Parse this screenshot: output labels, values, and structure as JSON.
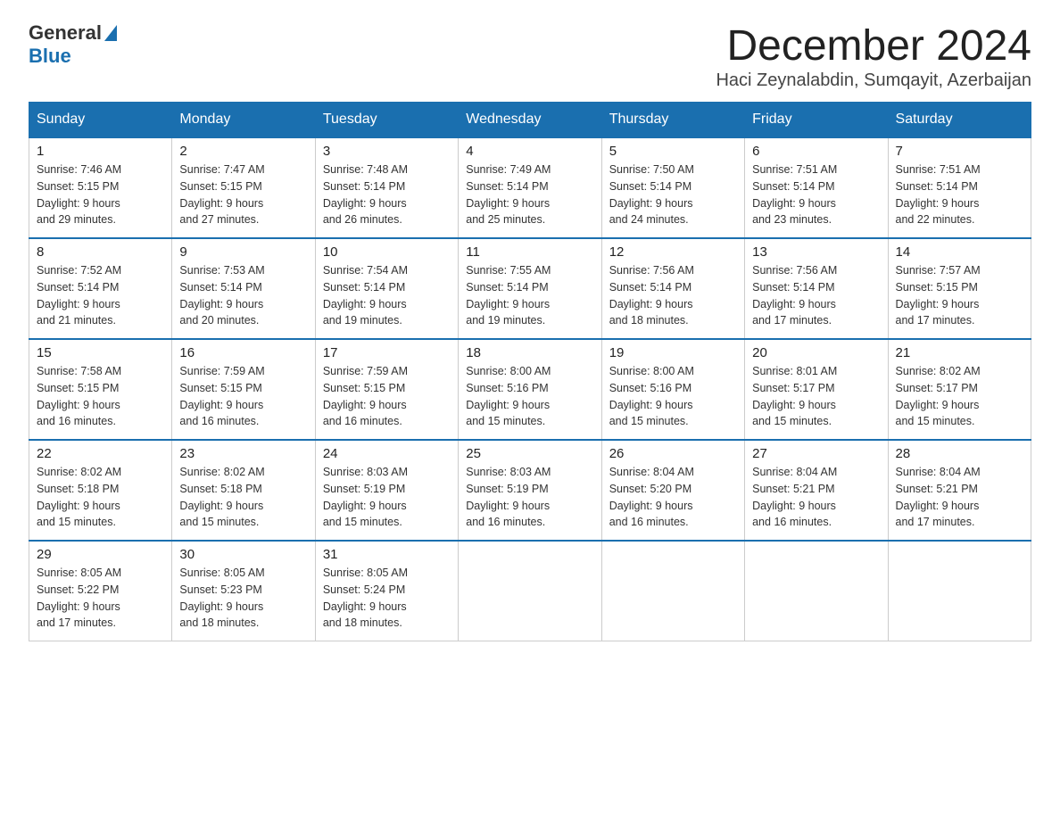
{
  "header": {
    "logo": {
      "general": "General",
      "blue": "Blue"
    },
    "title": "December 2024",
    "subtitle": "Haci Zeynalabdin, Sumqayit, Azerbaijan"
  },
  "days_of_week": [
    "Sunday",
    "Monday",
    "Tuesday",
    "Wednesday",
    "Thursday",
    "Friday",
    "Saturday"
  ],
  "weeks": [
    [
      {
        "day": "1",
        "sunrise": "7:46 AM",
        "sunset": "5:15 PM",
        "daylight": "9 hours and 29 minutes."
      },
      {
        "day": "2",
        "sunrise": "7:47 AM",
        "sunset": "5:15 PM",
        "daylight": "9 hours and 27 minutes."
      },
      {
        "day": "3",
        "sunrise": "7:48 AM",
        "sunset": "5:14 PM",
        "daylight": "9 hours and 26 minutes."
      },
      {
        "day": "4",
        "sunrise": "7:49 AM",
        "sunset": "5:14 PM",
        "daylight": "9 hours and 25 minutes."
      },
      {
        "day": "5",
        "sunrise": "7:50 AM",
        "sunset": "5:14 PM",
        "daylight": "9 hours and 24 minutes."
      },
      {
        "day": "6",
        "sunrise": "7:51 AM",
        "sunset": "5:14 PM",
        "daylight": "9 hours and 23 minutes."
      },
      {
        "day": "7",
        "sunrise": "7:51 AM",
        "sunset": "5:14 PM",
        "daylight": "9 hours and 22 minutes."
      }
    ],
    [
      {
        "day": "8",
        "sunrise": "7:52 AM",
        "sunset": "5:14 PM",
        "daylight": "9 hours and 21 minutes."
      },
      {
        "day": "9",
        "sunrise": "7:53 AM",
        "sunset": "5:14 PM",
        "daylight": "9 hours and 20 minutes."
      },
      {
        "day": "10",
        "sunrise": "7:54 AM",
        "sunset": "5:14 PM",
        "daylight": "9 hours and 19 minutes."
      },
      {
        "day": "11",
        "sunrise": "7:55 AM",
        "sunset": "5:14 PM",
        "daylight": "9 hours and 19 minutes."
      },
      {
        "day": "12",
        "sunrise": "7:56 AM",
        "sunset": "5:14 PM",
        "daylight": "9 hours and 18 minutes."
      },
      {
        "day": "13",
        "sunrise": "7:56 AM",
        "sunset": "5:14 PM",
        "daylight": "9 hours and 17 minutes."
      },
      {
        "day": "14",
        "sunrise": "7:57 AM",
        "sunset": "5:15 PM",
        "daylight": "9 hours and 17 minutes."
      }
    ],
    [
      {
        "day": "15",
        "sunrise": "7:58 AM",
        "sunset": "5:15 PM",
        "daylight": "9 hours and 16 minutes."
      },
      {
        "day": "16",
        "sunrise": "7:59 AM",
        "sunset": "5:15 PM",
        "daylight": "9 hours and 16 minutes."
      },
      {
        "day": "17",
        "sunrise": "7:59 AM",
        "sunset": "5:15 PM",
        "daylight": "9 hours and 16 minutes."
      },
      {
        "day": "18",
        "sunrise": "8:00 AM",
        "sunset": "5:16 PM",
        "daylight": "9 hours and 15 minutes."
      },
      {
        "day": "19",
        "sunrise": "8:00 AM",
        "sunset": "5:16 PM",
        "daylight": "9 hours and 15 minutes."
      },
      {
        "day": "20",
        "sunrise": "8:01 AM",
        "sunset": "5:17 PM",
        "daylight": "9 hours and 15 minutes."
      },
      {
        "day": "21",
        "sunrise": "8:02 AM",
        "sunset": "5:17 PM",
        "daylight": "9 hours and 15 minutes."
      }
    ],
    [
      {
        "day": "22",
        "sunrise": "8:02 AM",
        "sunset": "5:18 PM",
        "daylight": "9 hours and 15 minutes."
      },
      {
        "day": "23",
        "sunrise": "8:02 AM",
        "sunset": "5:18 PM",
        "daylight": "9 hours and 15 minutes."
      },
      {
        "day": "24",
        "sunrise": "8:03 AM",
        "sunset": "5:19 PM",
        "daylight": "9 hours and 15 minutes."
      },
      {
        "day": "25",
        "sunrise": "8:03 AM",
        "sunset": "5:19 PM",
        "daylight": "9 hours and 16 minutes."
      },
      {
        "day": "26",
        "sunrise": "8:04 AM",
        "sunset": "5:20 PM",
        "daylight": "9 hours and 16 minutes."
      },
      {
        "day": "27",
        "sunrise": "8:04 AM",
        "sunset": "5:21 PM",
        "daylight": "9 hours and 16 minutes."
      },
      {
        "day": "28",
        "sunrise": "8:04 AM",
        "sunset": "5:21 PM",
        "daylight": "9 hours and 17 minutes."
      }
    ],
    [
      {
        "day": "29",
        "sunrise": "8:05 AM",
        "sunset": "5:22 PM",
        "daylight": "9 hours and 17 minutes."
      },
      {
        "day": "30",
        "sunrise": "8:05 AM",
        "sunset": "5:23 PM",
        "daylight": "9 hours and 18 minutes."
      },
      {
        "day": "31",
        "sunrise": "8:05 AM",
        "sunset": "5:24 PM",
        "daylight": "9 hours and 18 minutes."
      },
      null,
      null,
      null,
      null
    ]
  ],
  "labels": {
    "sunrise": "Sunrise:",
    "sunset": "Sunset:",
    "daylight": "Daylight:"
  }
}
